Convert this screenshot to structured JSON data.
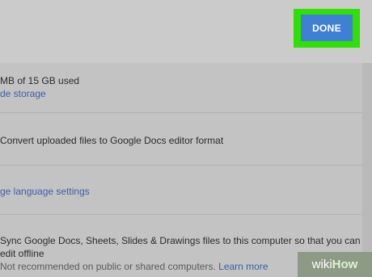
{
  "header": {
    "done_label": "DONE"
  },
  "storage": {
    "usage_text": "MB of 15 GB used",
    "upgrade_link": "de storage"
  },
  "convert": {
    "label": "Convert uploaded files to Google Docs editor format"
  },
  "language": {
    "link": "ge language settings"
  },
  "offline": {
    "line1": "Sync Google Docs, Sheets, Slides & Drawings files to this computer so that you can",
    "line2": "edit offline",
    "note": "Not recommended on public or shared computers.",
    "learn_more": "Learn more"
  },
  "watermark": {
    "wiki": "wiki",
    "how": "How"
  }
}
